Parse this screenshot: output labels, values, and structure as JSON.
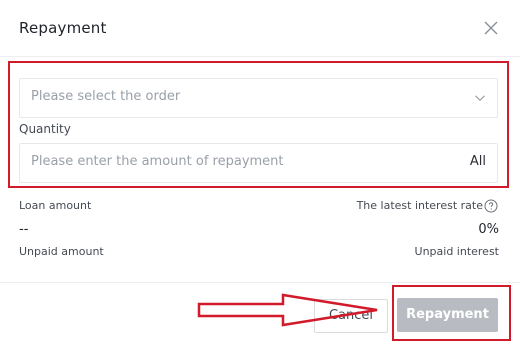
{
  "dialog": {
    "title": "Repayment",
    "close_icon": "close-icon"
  },
  "order_select": {
    "placeholder": "Please select the order",
    "icon": "chevron-down-icon"
  },
  "quantity": {
    "label": "Quantity",
    "placeholder": "Please enter the amount of repayment",
    "all_label": "All"
  },
  "loan": {
    "loan_amount_label": "Loan amount",
    "loan_amount_value": "--",
    "interest_rate_label": "The latest interest rate",
    "interest_rate_value": "0%",
    "unpaid_amount_label": "Unpaid amount",
    "unpaid_interest_label": "Unpaid interest",
    "help_icon": "question-icon"
  },
  "footer": {
    "cancel_label": "Cancel",
    "repayment_label": "Repayment"
  },
  "annotations": {
    "highlight_color": "#d21b2a",
    "arrow_icon": "arrow-right-icon"
  }
}
